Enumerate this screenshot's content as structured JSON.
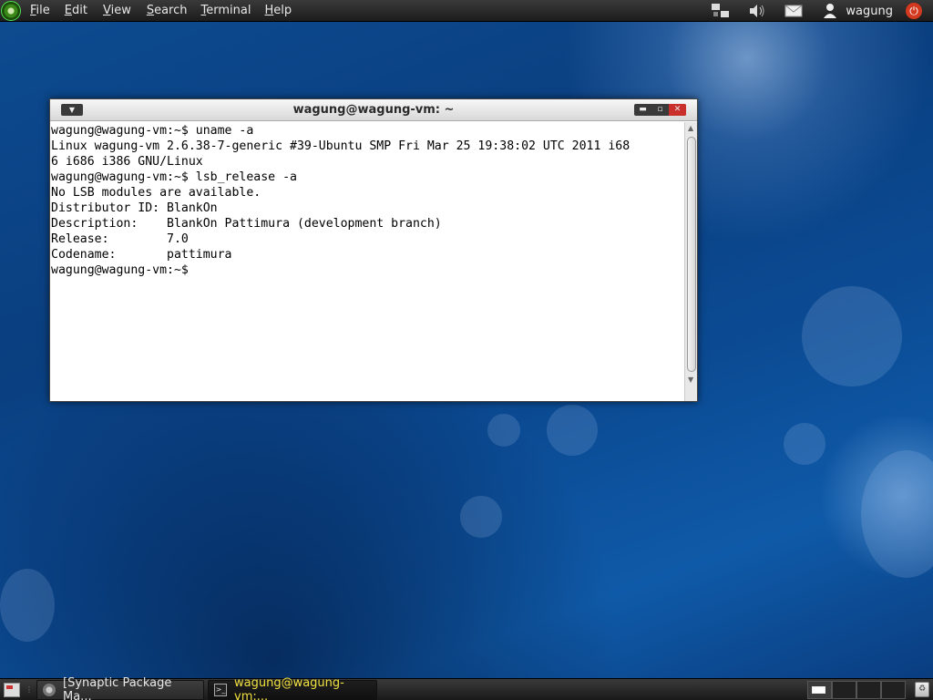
{
  "top_panel": {
    "menus": [
      "File",
      "Edit",
      "View",
      "Search",
      "Terminal",
      "Help"
    ],
    "user": "wagung",
    "tray_icons": [
      "network-icon",
      "volume-icon",
      "mail-icon",
      "user-icon",
      "power-icon"
    ]
  },
  "terminal": {
    "title": "wagung@wagung-vm: ~",
    "lines": [
      "wagung@wagung-vm:~$ uname -a",
      "Linux wagung-vm 2.6.38-7-generic #39-Ubuntu SMP Fri Mar 25 19:38:02 UTC 2011 i68",
      "6 i686 i386 GNU/Linux",
      "wagung@wagung-vm:~$ lsb_release -a",
      "No LSB modules are available.",
      "Distributor ID: BlankOn",
      "Description:    BlankOn Pattimura (development branch)",
      "Release:        7.0",
      "Codename:       pattimura",
      "wagung@wagung-vm:~$ "
    ]
  },
  "taskbar": {
    "tasks": [
      {
        "label": "[Synaptic Package Ma...",
        "active": false
      },
      {
        "label": "wagung@wagung-vm:...",
        "active": true
      }
    ]
  },
  "colors": {
    "desktop": "#0b4b94",
    "active_task_text": "#f0e040",
    "close_button": "#c9302c",
    "power_button": "#d2391f"
  }
}
